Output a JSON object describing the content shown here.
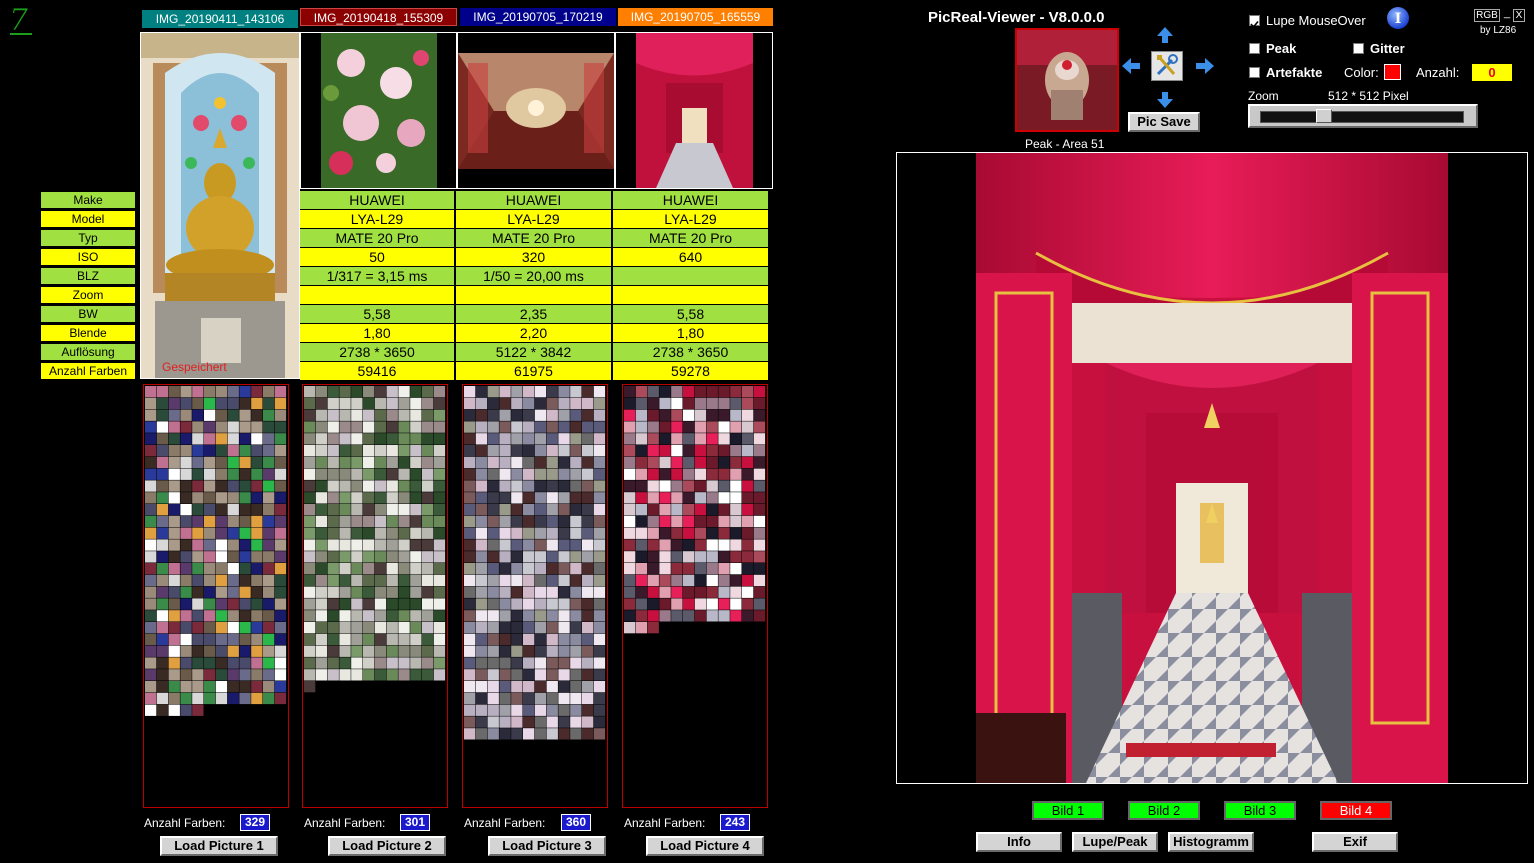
{
  "app": {
    "title": "PicReal-Viewer - V8.0.0.0",
    "by": "by LZ86",
    "rgb_label": "RGB",
    "min_label": "_",
    "close_label": "X",
    "logo": "7"
  },
  "images": [
    {
      "name": "IMG_20190411_143106",
      "tab_color": "#008080"
    },
    {
      "name": "IMG_20190418_155309",
      "tab_color": "#8b0000"
    },
    {
      "name": "IMG_20190705_170219",
      "tab_color": "#00008b"
    },
    {
      "name": "IMG_20190705_165559",
      "tab_color": "#ff7f00"
    }
  ],
  "meta_labels": [
    "Make",
    "Model",
    "Typ",
    "ISO",
    "BLZ",
    "Zoom",
    "BW",
    "Blende",
    "Auflösung",
    "Anzahl Farben"
  ],
  "meta_columns": [
    {
      "make": "HUAWEI",
      "model": "LYA-L29",
      "typ": "MATE 20 Pro",
      "iso": "50",
      "blz": "1/317 = 3,15 ms",
      "zoom": "",
      "bw": "5,58",
      "blende": "1,80",
      "aufloesung": "2738 * 3650",
      "farben": "59416"
    },
    {
      "make": "HUAWEI",
      "model": "LYA-L29",
      "typ": "MATE 20 Pro",
      "iso": "320",
      "blz": "1/50 = 20,00 ms",
      "zoom": "",
      "bw": "2,35",
      "blende": "2,20",
      "aufloesung": "5122 * 3842",
      "farben": "61975"
    },
    {
      "make": "HUAWEI",
      "model": "LYA-L29",
      "typ": "MATE 20 Pro",
      "iso": "640",
      "blz": "",
      "zoom": "",
      "bw": "5,58",
      "blende": "1,80",
      "aufloesung": "2738 * 3650",
      "farben": "59278"
    }
  ],
  "gespeichert": "Gespeichert",
  "palettes": [
    {
      "count_label": "Anzahl Farben:",
      "count": "329",
      "load_label": "Load Picture 1",
      "cells": 329
    },
    {
      "count_label": "Anzahl Farben:",
      "count": "301",
      "load_label": "Load Picture 2",
      "cells": 301
    },
    {
      "count_label": "Anzahl Farben:",
      "count": "360",
      "load_label": "Load Picture 3",
      "cells": 360
    },
    {
      "count_label": "Anzahl Farben:",
      "count": "243",
      "load_label": "Load Picture 4",
      "cells": 243
    }
  ],
  "controls": {
    "lupe_mouseover": "Lupe MouseOver",
    "peak": "Peak",
    "gitter": "Gitter",
    "artefakte": "Artefakte",
    "color_label": "Color:",
    "color_value": "#ff0000",
    "anzahl_label": "Anzahl:",
    "anzahl_value": "0",
    "zoom_label": "Zoom",
    "zoom_value": "512 * 512 Pixel",
    "zoom_fraction": 0.3,
    "pic_save": "Pic Save",
    "peak_caption": "Peak - Area 51",
    "info_icon": "info-icon"
  },
  "bild_buttons": [
    {
      "label": "Bild 1",
      "color": "#00ff00"
    },
    {
      "label": "Bild 2",
      "color": "#00ff00"
    },
    {
      "label": "Bild 3",
      "color": "#00ff00"
    },
    {
      "label": "Bild 4",
      "color": "#ff0000"
    }
  ],
  "bottom_buttons": {
    "info": "Info",
    "lupe_peak": "Lupe/Peak",
    "histogramm": "Histogramm",
    "exit": "Exif"
  }
}
